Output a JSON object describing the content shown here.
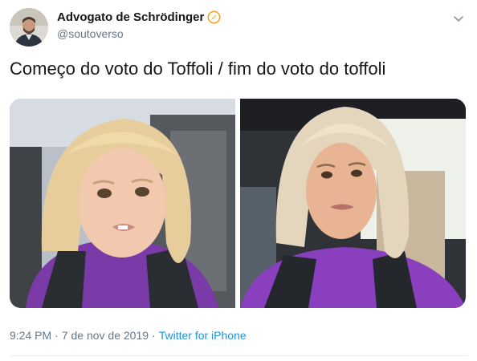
{
  "author": {
    "display_name": "Advogato de Schrödinger",
    "handle": "@soutoverso"
  },
  "tweet": {
    "text": "Começo do voto do Toffoli / fim do voto do toffoli",
    "media": [
      {
        "subject": "Menina loira olhando de lado com expressão desconfiada"
      },
      {
        "subject": "Mulher loira no carro imitando a expressão"
      }
    ]
  },
  "meta": {
    "time": "9:24 PM",
    "sep1": "·",
    "date": "7 de nov de 2019",
    "sep2": "·",
    "source": "Twitter for iPhone"
  },
  "icons": {
    "verified_badge": "compass-icon",
    "menu": "chevron-down-icon"
  },
  "colors": {
    "text_primary": "#14171a",
    "text_secondary": "#657786",
    "link": "#1b95e0",
    "badge": "#f5a623"
  }
}
